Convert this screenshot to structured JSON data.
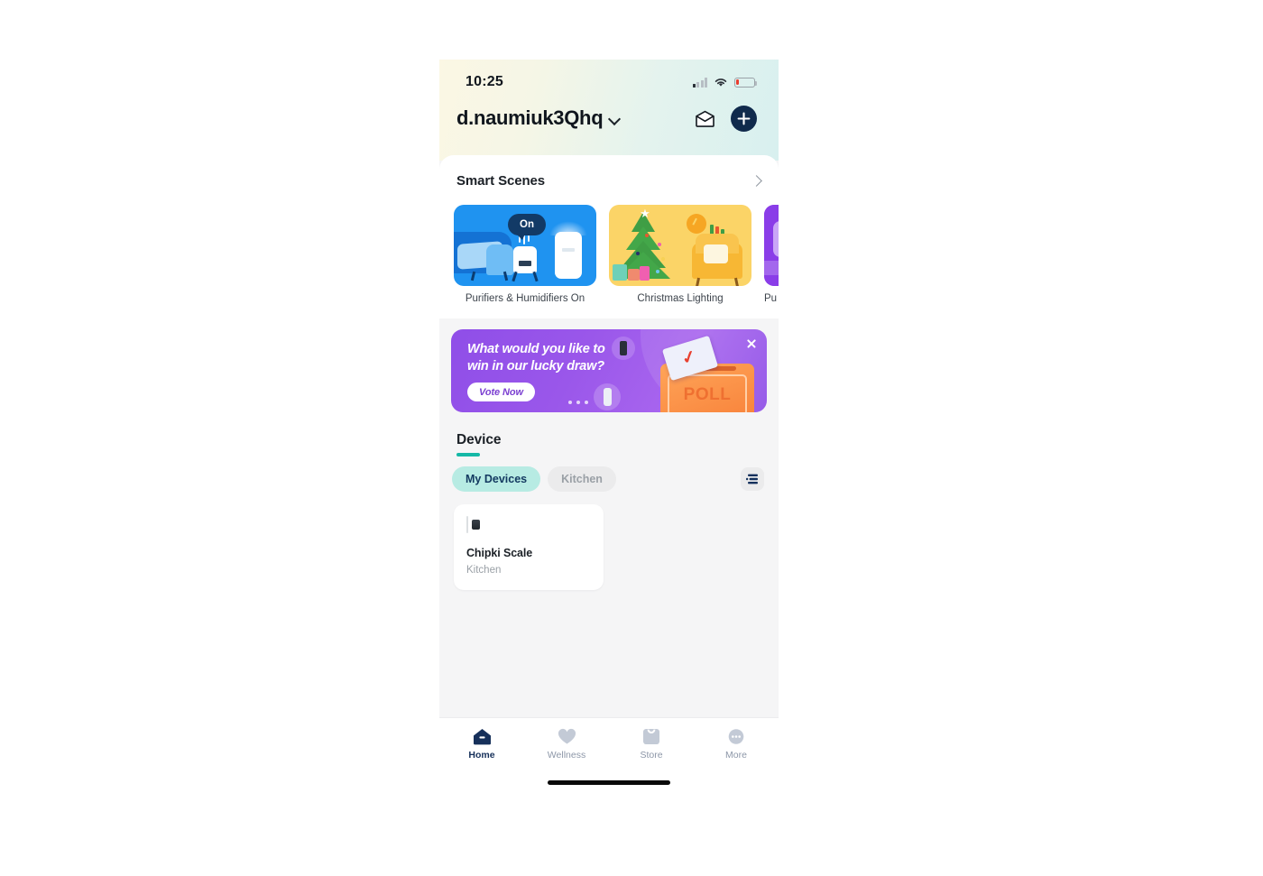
{
  "status_bar": {
    "time": "10:25",
    "signal_icon": "cellular-signal-icon",
    "wifi_icon": "wifi-icon",
    "battery_icon": "battery-low-icon"
  },
  "header": {
    "account_name": "d.naumiuk3Qhq",
    "dropdown_icon": "chevron-down-icon",
    "mail_icon": "mail-icon",
    "add_icon": "plus-icon",
    "gradient_from": "#fbf7e4",
    "gradient_to": "#d8f0ef"
  },
  "smart_scenes": {
    "title": "Smart Scenes",
    "more_icon": "chevron-right-icon",
    "scenes": [
      {
        "label": "Purifiers & Humidifiers On",
        "badge": "On",
        "color": "#1f93f0"
      },
      {
        "label": "Christmas Lighting",
        "color": "#fbd467"
      },
      {
        "label": "Pu",
        "color": "#9b4ff0"
      }
    ]
  },
  "banner": {
    "line1": "What would you like to",
    "line2": "win in our lucky draw?",
    "cta": "Vote Now",
    "poll_label": "POLL",
    "close_icon": "close-icon",
    "accent": "#9a57ea"
  },
  "device": {
    "title": "Device",
    "accent": "#15b8a6",
    "tabs": [
      {
        "label": "My Devices",
        "active": true
      },
      {
        "label": "Kitchen",
        "active": false
      }
    ],
    "list_icon": "list-view-icon",
    "cards": [
      {
        "name": "Chipki Scale",
        "room": "Kitchen",
        "image": "smart-scale-image"
      }
    ]
  },
  "tabbar": {
    "items": [
      {
        "label": "Home",
        "icon": "home-icon",
        "active": true
      },
      {
        "label": "Wellness",
        "icon": "heart-icon",
        "active": false
      },
      {
        "label": "Store",
        "icon": "shopping-bag-icon",
        "active": false
      },
      {
        "label": "More",
        "icon": "more-dots-icon",
        "active": false
      }
    ]
  }
}
